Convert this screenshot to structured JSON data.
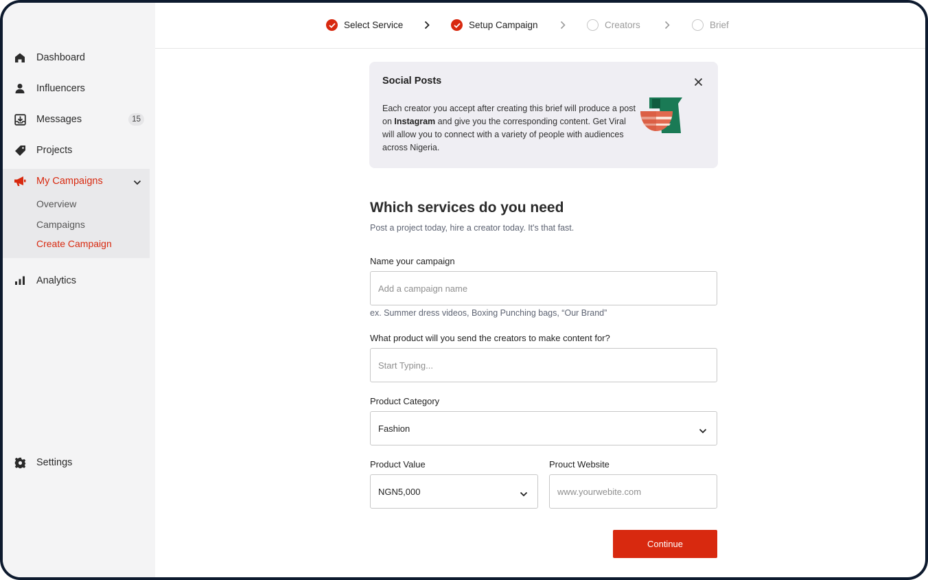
{
  "sidebar": {
    "items": [
      {
        "label": "Dashboard",
        "icon": "home-icon"
      },
      {
        "label": "Influencers",
        "icon": "user-icon"
      },
      {
        "label": "Messages",
        "icon": "inbox-icon",
        "badge": "15"
      },
      {
        "label": "Projects",
        "icon": "tag-icon"
      },
      {
        "label": "My Campaigns",
        "icon": "megaphone-icon",
        "active": true
      },
      {
        "label": "Analytics",
        "icon": "bar-chart-icon"
      },
      {
        "label": "Settings",
        "icon": "gear-icon"
      }
    ],
    "submenu": [
      {
        "label": "Overview"
      },
      {
        "label": "Campaigns"
      },
      {
        "label": "Create Campaign",
        "active": true
      }
    ]
  },
  "stepper": {
    "steps": [
      {
        "label": "Select Service",
        "status": "done"
      },
      {
        "label": "Setup Campaign",
        "status": "done"
      },
      {
        "label": "Creators",
        "status": "todo"
      },
      {
        "label": "Brief",
        "status": "todo"
      }
    ]
  },
  "banner": {
    "title": "Social Posts",
    "body_pre": "Each creator you accept after creating this brief will produce a post on ",
    "body_bold": "Instagram",
    "body_post": " and give you the corresponding content. Get Viral will allow you to connect with a variety of people with audiences across Nigeria."
  },
  "main": {
    "heading": "Which services do you need",
    "subheading": "Post a project today, hire a creator today. It's that fast."
  },
  "form": {
    "campaign_name": {
      "label": "Name your campaign",
      "placeholder": "Add a campaign name",
      "value": "",
      "hint": "ex. Summer dress videos, Boxing Punching bags, “Our Brand”"
    },
    "product": {
      "label": "What product will you send the creators to make content for?",
      "placeholder": "Start Typing...",
      "value": ""
    },
    "category": {
      "label": "Product Category",
      "value": "Fashion"
    },
    "product_value": {
      "label": "Product Value",
      "value": "NGN5,000"
    },
    "website": {
      "label": "Prouct Website",
      "placeholder": "www.yourwebite.com",
      "value": ""
    },
    "continue_label": "Continue"
  },
  "colors": {
    "accent": "#d8290f",
    "sidebar_bg": "#f4f4f5",
    "banner_bg": "#efeef3"
  }
}
